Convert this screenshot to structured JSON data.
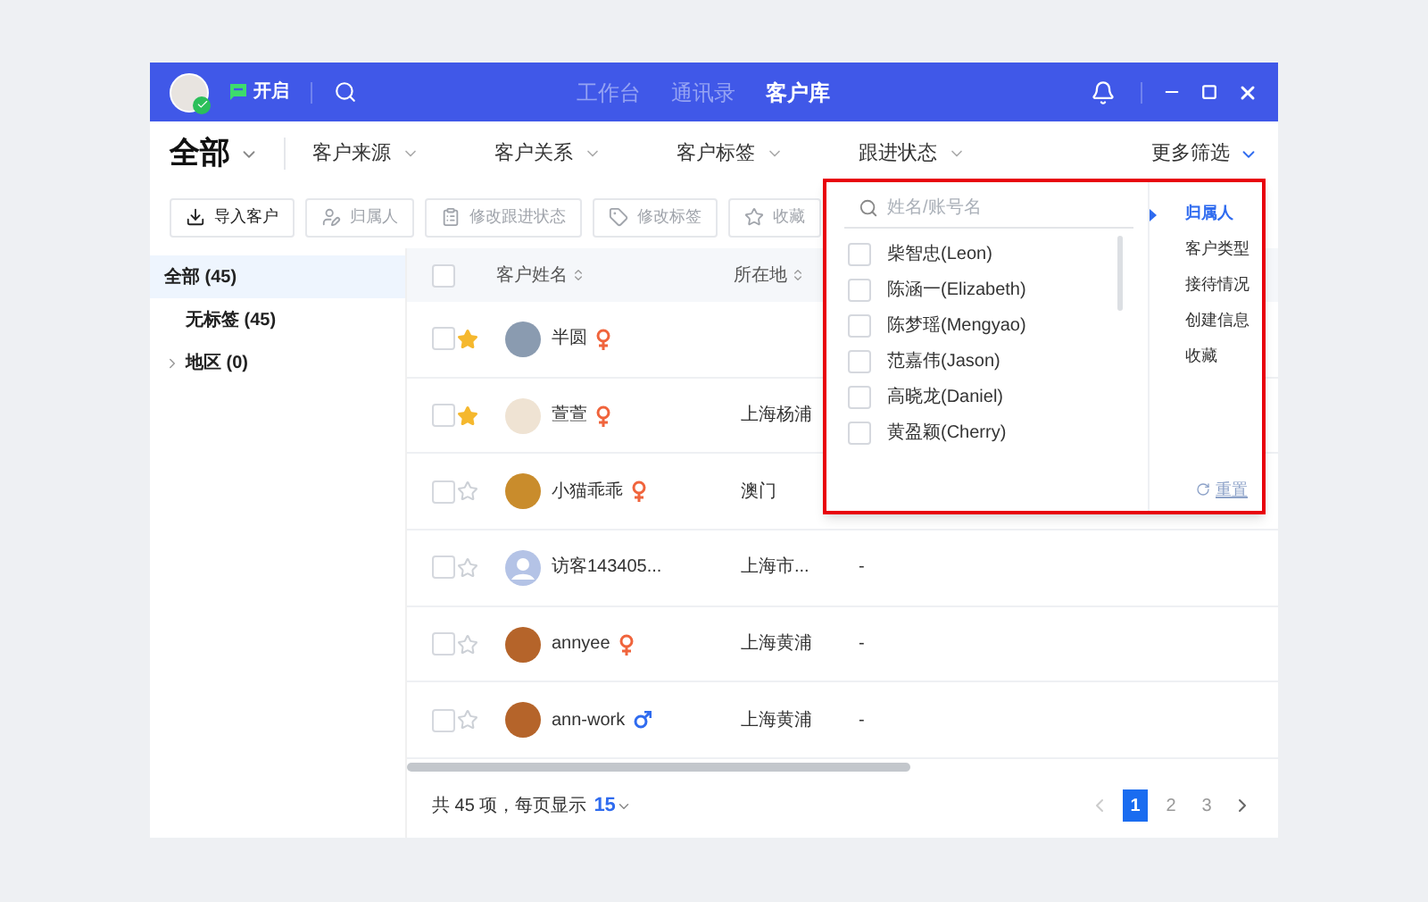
{
  "title_bar": {
    "status_label": "开启",
    "nav_tabs": [
      {
        "label": "工作台",
        "selected": false
      },
      {
        "label": "通讯录",
        "selected": false
      },
      {
        "label": "客户库",
        "selected": true
      }
    ]
  },
  "filters": {
    "scope": "全部",
    "items": [
      "客户来源",
      "客户关系",
      "客户标签",
      "跟进状态"
    ],
    "more": "更多筛选"
  },
  "toolbar": [
    {
      "label": "导入客户",
      "kind": "import",
      "disabled": false
    },
    {
      "label": "归属人",
      "kind": "owner",
      "disabled": true
    },
    {
      "label": "修改跟进状态",
      "kind": "status",
      "disabled": true
    },
    {
      "label": "修改标签",
      "kind": "tag",
      "disabled": true
    },
    {
      "label": "收藏",
      "kind": "star",
      "disabled": true
    }
  ],
  "sidebar": {
    "items": [
      {
        "label": "全部 (45)",
        "selected": true,
        "children": [
          {
            "label": "无标签 (45)",
            "selected": false
          }
        ]
      },
      {
        "label": "地区 (0)",
        "selected": false,
        "expanded": false
      }
    ]
  },
  "table": {
    "all_selected": false,
    "columns": [
      {
        "label": "客户姓名"
      },
      {
        "label": "所在地"
      }
    ],
    "rows": [
      {
        "selected": false,
        "starred": true,
        "has_photo": true,
        "name": "半圆",
        "female": true,
        "male": false
      },
      {
        "selected": false,
        "starred": true,
        "has_photo": true,
        "name": "萱萱",
        "female": true,
        "male": false,
        "location": "上海杨浦"
      },
      {
        "selected": false,
        "starred": false,
        "has_photo": true,
        "name": "小猫乖乖",
        "female": true,
        "male": false,
        "location": "澳门"
      },
      {
        "selected": false,
        "starred": false,
        "has_photo": false,
        "name": "访客143405...",
        "female": false,
        "male": false,
        "location": "上海市...",
        "column_3": "-"
      },
      {
        "selected": false,
        "starred": false,
        "has_photo": true,
        "name": "annyee",
        "female": true,
        "male": false,
        "location": "上海黄浦",
        "column_3": "-"
      },
      {
        "selected": false,
        "starred": false,
        "has_photo": true,
        "name": "ann-work",
        "female": false,
        "male": true,
        "location": "上海黄浦",
        "column_3": "-"
      }
    ]
  },
  "pagination": {
    "summary": "共 45 项，每页显示",
    "page_size": "15",
    "pages": [
      {
        "label": "1",
        "selected": true
      },
      {
        "label": "2",
        "selected": false
      },
      {
        "label": "3",
        "selected": false
      }
    ]
  },
  "filter_popup": {
    "search": {
      "placeholder": "姓名/账号名"
    },
    "options": [
      {
        "label": "柴智忠(Leon)",
        "checked": false
      },
      {
        "label": "陈涵一(Elizabeth)",
        "checked": false
      },
      {
        "label": "陈梦瑶(Mengyao)",
        "checked": false
      },
      {
        "label": "范嘉伟(Jason)",
        "checked": false
      },
      {
        "label": "高晓龙(Daniel)",
        "checked": false
      },
      {
        "label": "黄盈颖(Cherry)",
        "checked": false
      }
    ],
    "categories": [
      {
        "label": "归属人",
        "selected": true
      },
      {
        "label": "客户类型",
        "selected": false
      },
      {
        "label": "接待情况",
        "selected": false
      },
      {
        "label": "创建信息",
        "selected": false
      },
      {
        "label": "收藏",
        "selected": false
      }
    ],
    "reset": "重置"
  }
}
